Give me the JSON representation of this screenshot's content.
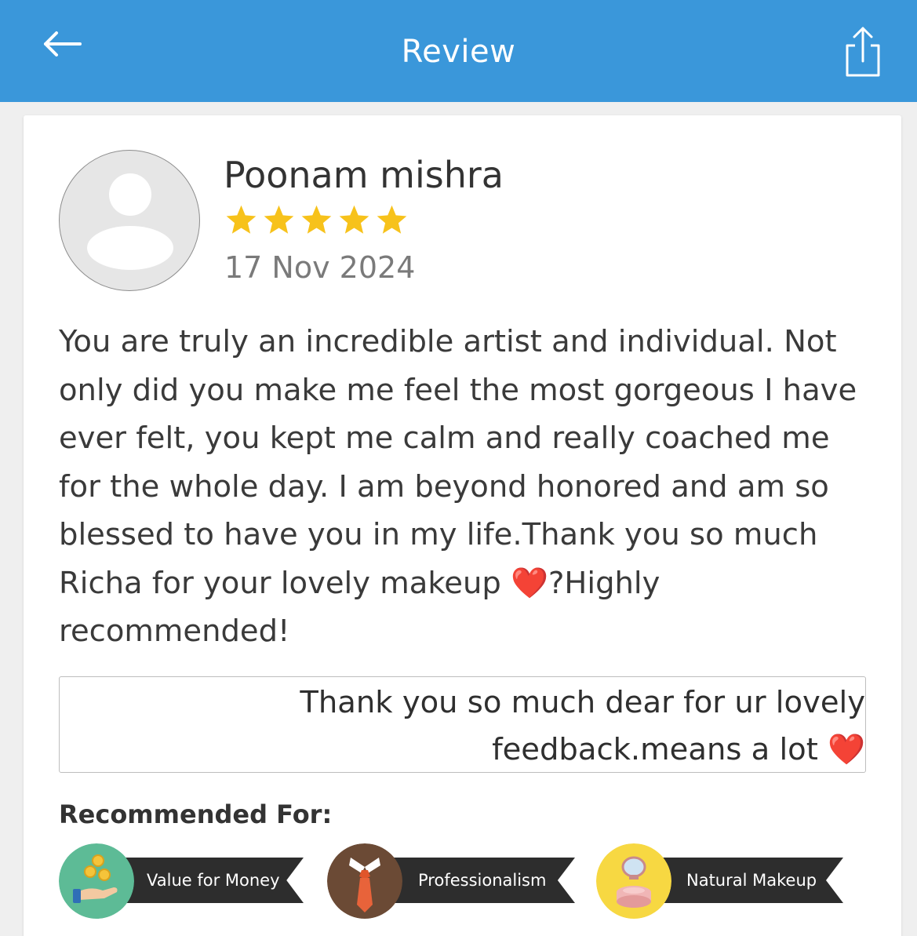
{
  "header": {
    "title": "Review",
    "background_color": "#3a97da",
    "back_icon": "arrow-left-icon",
    "share_icon": "share-icon"
  },
  "review": {
    "reviewer_name": "Poonam mishra",
    "rating": 5,
    "rating_max": 5,
    "star_color": "#f7c21b",
    "date": "17 Nov 2024",
    "text": "You are truly an incredible artist and individual. Not only did you make me feel the most gorgeous I have ever felt, you kept me calm and really coached me for the whole day. I am beyond honored and am so blessed to have you in my life.Thank you so much Richa for your lovely makeup ❤️?Highly recommended!",
    "reply": "Thank you so much dear for ur lovely feedback.means a lot ❤️"
  },
  "recommended": {
    "heading": "Recommended For:",
    "items": [
      {
        "label": "Value for Money",
        "icon": "coins-hand-icon",
        "icon_bg": "#5dbb96"
      },
      {
        "label": "Professionalism",
        "icon": "suit-tie-icon",
        "icon_bg": "#6b4a35"
      },
      {
        "label": "Natural Makeup",
        "icon": "compact-powder-icon",
        "icon_bg": "#f7d842"
      }
    ]
  }
}
